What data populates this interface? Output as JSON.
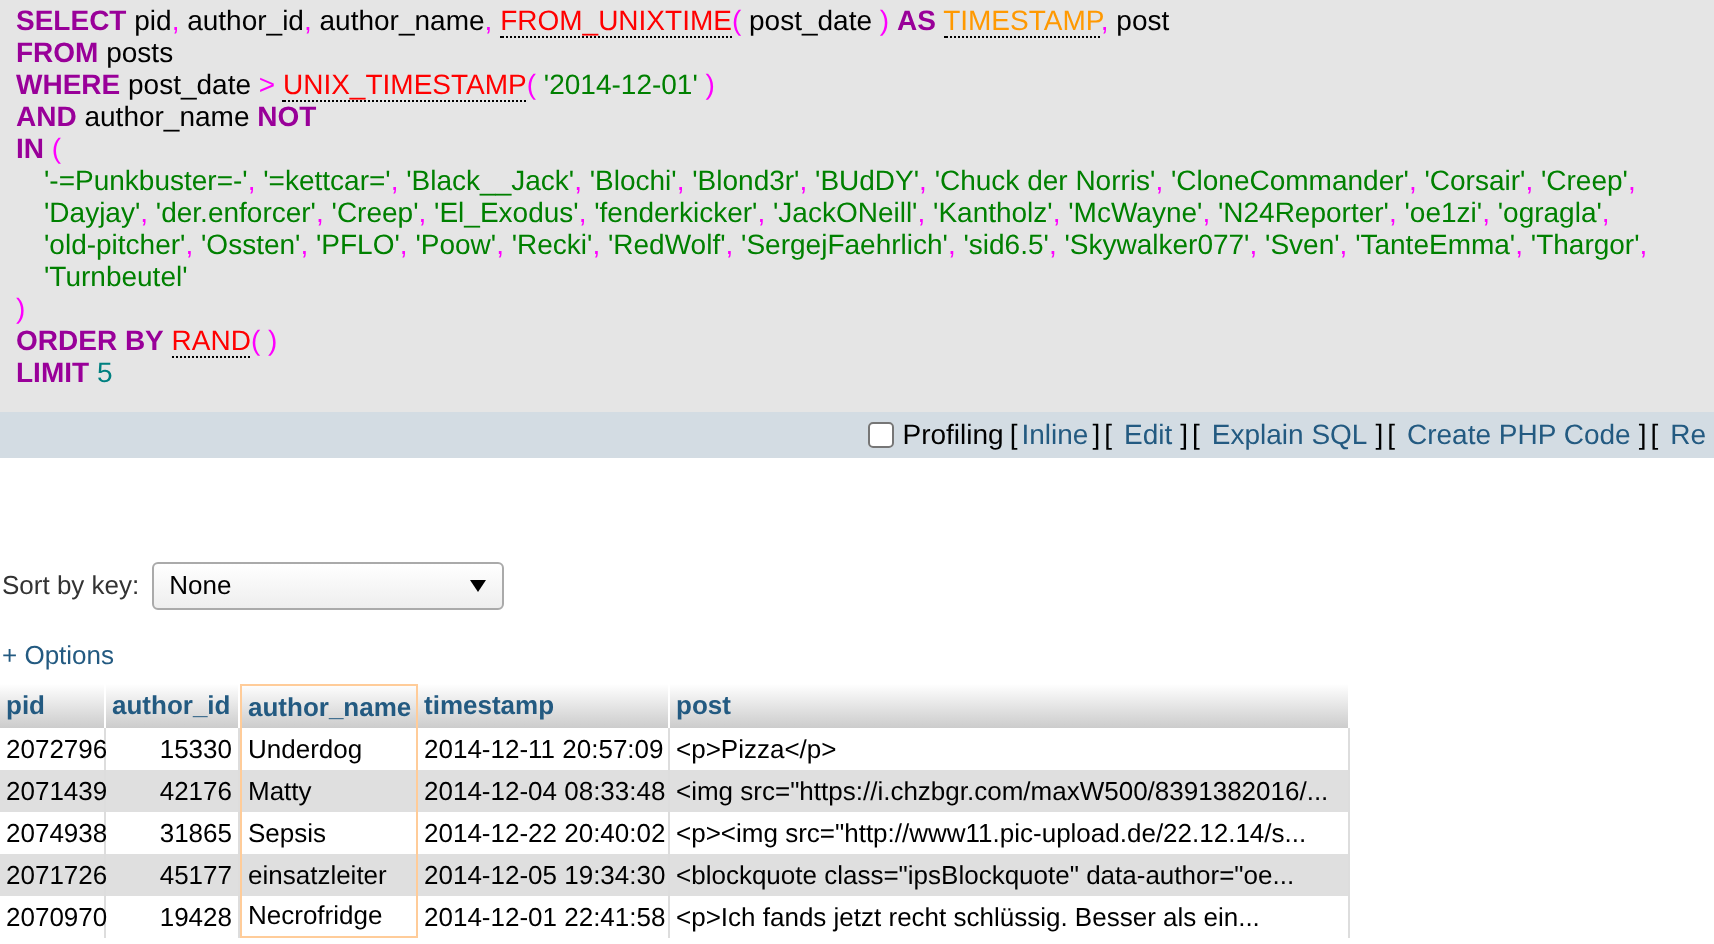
{
  "sql_query": {
    "lines": [
      {
        "tokens": [
          {
            "kind": "keyword",
            "text": "SELECT"
          },
          {
            "kind": "plain",
            "text": " pid"
          },
          {
            "kind": "punct",
            "text": ","
          },
          {
            "kind": "plain",
            "text": " author_id"
          },
          {
            "kind": "punct",
            "text": ","
          },
          {
            "kind": "plain",
            "text": " author_name"
          },
          {
            "kind": "punct",
            "text": ","
          },
          {
            "kind": "function",
            "text": " FROM_UNIXTIME"
          },
          {
            "kind": "punct",
            "text": "("
          },
          {
            "kind": "plain",
            "text": " post_date"
          },
          {
            "kind": "punct",
            "text": " )"
          },
          {
            "kind": "keyword",
            "text": " AS"
          },
          {
            "kind": "alias",
            "text": " TIMESTAMP"
          },
          {
            "kind": "punct",
            "text": ","
          },
          {
            "kind": "plain",
            "text": " post"
          }
        ]
      },
      {
        "tokens": [
          {
            "kind": "keyword",
            "text": "FROM"
          },
          {
            "kind": "plain",
            "text": " posts"
          }
        ]
      },
      {
        "tokens": [
          {
            "kind": "keyword",
            "text": "WHERE"
          },
          {
            "kind": "plain",
            "text": " post_date"
          },
          {
            "kind": "punct",
            "text": " >"
          },
          {
            "kind": "function",
            "text": " UNIX_TIMESTAMP"
          },
          {
            "kind": "punct",
            "text": "("
          },
          {
            "kind": "string",
            "text": " '2014-12-01'"
          },
          {
            "kind": "punct",
            "text": " )"
          }
        ]
      },
      {
        "tokens": [
          {
            "kind": "keyword",
            "text": "AND"
          },
          {
            "kind": "plain",
            "text": " author_name"
          },
          {
            "kind": "keyword",
            "text": " NOT"
          }
        ]
      },
      {
        "tokens": [
          {
            "kind": "keyword",
            "text": "IN"
          },
          {
            "kind": "punct",
            "text": " ("
          }
        ],
        "children": [
          {
            "tokens": [
              {
                "kind": "string",
                "text": "'-=Punkbuster=-'",
                "suffix": ","
              },
              {
                "kind": "string",
                "text": " '=kettcar='",
                "suffix": ","
              },
              {
                "kind": "string",
                "text": " 'Black__Jack'",
                "suffix": ","
              },
              {
                "kind": "string",
                "text": " 'Blochi'",
                "suffix": ","
              },
              {
                "kind": "string",
                "text": " 'Blond3r'",
                "suffix": ","
              },
              {
                "kind": "string",
                "text": " 'BUdDY'",
                "suffix": ","
              },
              {
                "kind": "string",
                "text": " 'Chuck der Norris'",
                "suffix": ","
              },
              {
                "kind": "string",
                "text": " 'CloneCommander'",
                "suffix": ","
              },
              {
                "kind": "string",
                "text": " 'Corsair'",
                "suffix": ","
              },
              {
                "kind": "string",
                "text": " 'Creep'",
                "suffix": ","
              }
            ]
          },
          {
            "tokens": [
              {
                "kind": "string",
                "text": "'Dayjay'",
                "suffix": ","
              },
              {
                "kind": "string",
                "text": " 'der.enforcer'",
                "suffix": ","
              },
              {
                "kind": "string",
                "text": " 'Creep'",
                "suffix": ","
              },
              {
                "kind": "string",
                "text": " 'El_Exodus'",
                "suffix": ","
              },
              {
                "kind": "string",
                "text": " 'fenderkicker'",
                "suffix": ","
              },
              {
                "kind": "string",
                "text": " 'JackONeill'",
                "suffix": ","
              },
              {
                "kind": "string",
                "text": " 'Kantholz'",
                "suffix": ","
              },
              {
                "kind": "string",
                "text": " 'McWayne'",
                "suffix": ","
              },
              {
                "kind": "string",
                "text": " 'N24Reporter'",
                "suffix": ","
              },
              {
                "kind": "string",
                "text": " 'oe1zi'",
                "suffix": ","
              },
              {
                "kind": "string",
                "text": " 'ogragla'",
                "suffix": ","
              }
            ]
          },
          {
            "tokens": [
              {
                "kind": "string",
                "text": "'old-pitcher'",
                "suffix": ","
              },
              {
                "kind": "string",
                "text": " 'Ossten'",
                "suffix": ","
              },
              {
                "kind": "string",
                "text": " 'PFLO'",
                "suffix": ","
              },
              {
                "kind": "string",
                "text": " 'Poow'",
                "suffix": ","
              },
              {
                "kind": "string",
                "text": " 'Recki'",
                "suffix": ","
              },
              {
                "kind": "string",
                "text": " 'RedWolf'",
                "suffix": ","
              },
              {
                "kind": "string",
                "text": " 'SergejFaehrlich'",
                "suffix": ","
              },
              {
                "kind": "string",
                "text": " 'sid6.5'",
                "suffix": ","
              },
              {
                "kind": "string",
                "text": " 'Skywalker077'",
                "suffix": ","
              },
              {
                "kind": "string",
                "text": " 'Sven'",
                "suffix": ","
              },
              {
                "kind": "string",
                "text": " 'TanteEmma'",
                "suffix": ","
              },
              {
                "kind": "string",
                "text": " 'Thargor'",
                "suffix": ","
              }
            ]
          },
          {
            "tokens": [
              {
                "kind": "string",
                "text": "'Turnbeutel'"
              }
            ]
          }
        ]
      },
      {
        "tokens": [
          {
            "kind": "punct",
            "text": ")"
          }
        ]
      },
      {
        "tokens": [
          {
            "kind": "keyword",
            "text": "ORDER BY"
          },
          {
            "kind": "function",
            "text": " RAND"
          },
          {
            "kind": "punct",
            "text": "( )"
          }
        ]
      },
      {
        "tokens": [
          {
            "kind": "keyword",
            "text": "LIMIT"
          },
          {
            "kind": "number",
            "text": " 5"
          }
        ]
      }
    ]
  },
  "query_toolbar": {
    "profiling": {
      "label": "Profiling",
      "checked": false
    },
    "items": [
      {
        "kind": "bracket",
        "text": "["
      },
      {
        "kind": "link",
        "text": "Inline"
      },
      {
        "kind": "bracket",
        "text": "]"
      },
      {
        "kind": "bracket",
        "text": "["
      },
      {
        "kind": "link",
        "text": "Edit"
      },
      {
        "kind": "bracket",
        "text": "]"
      },
      {
        "kind": "bracket",
        "text": "["
      },
      {
        "kind": "link",
        "text": "Explain SQL"
      },
      {
        "kind": "bracket",
        "text": "]"
      },
      {
        "kind": "bracket",
        "text": "["
      },
      {
        "kind": "link",
        "text": "Create PHP Code"
      },
      {
        "kind": "bracket",
        "text": "]"
      },
      {
        "kind": "bracket",
        "text": "["
      },
      {
        "kind": "link",
        "text": "Re"
      }
    ]
  },
  "sort_by_key": {
    "label": "Sort by key:",
    "value": "None"
  },
  "options_toggle": "+ Options",
  "table": {
    "columns": [
      {
        "label": "pid",
        "selected": false
      },
      {
        "label": "author_id",
        "selected": false
      },
      {
        "label": "author_name",
        "selected": true
      },
      {
        "label": "timestamp",
        "selected": false
      },
      {
        "label": "post",
        "selected": false
      }
    ],
    "rows": [
      [
        "2072796",
        "15330",
        "Underdog",
        "2014-12-11 20:57:09",
        "<p>Pizza</p>"
      ],
      [
        "2071439",
        "42176",
        "Matty",
        "2014-12-04 08:33:48",
        "<img src=\"https://i.chzbgr.com/maxW500/8391382016/..."
      ],
      [
        "2074938",
        "31865",
        "Sepsis",
        "2014-12-22 20:40:02",
        "<p><img src=\"http://www11.pic-upload.de/22.12.14/s..."
      ],
      [
        "2071726",
        "45177",
        "einsatzleiter",
        "2014-12-05 19:34:30",
        "<blockquote  class=\"ipsBlockquote\" data-author=\"oe..."
      ],
      [
        "2070970",
        "19428",
        "Necrofridge",
        "2014-12-01 22:41:58",
        "<p>Ich fands jetzt recht schlüssig. Besser als ein..."
      ]
    ]
  }
}
